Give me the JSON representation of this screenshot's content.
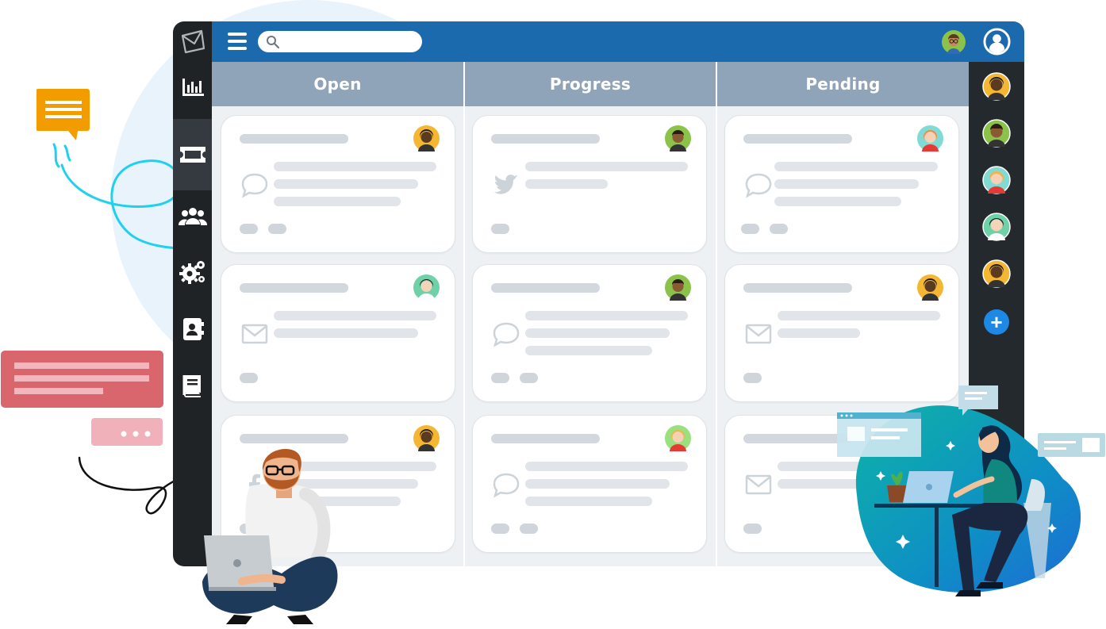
{
  "columns": [
    {
      "title": "Open",
      "cards": [
        {
          "channel": "chat-bubble-icon",
          "avatar": "dark-skin-woman"
        },
        {
          "channel": "envelope-icon",
          "avatar": "asian-woman"
        },
        {
          "channel": "facebook-icon",
          "avatar": "dark-skin-woman"
        }
      ]
    },
    {
      "title": "Progress",
      "cards": [
        {
          "channel": "twitter-icon",
          "avatar": "man-green"
        },
        {
          "channel": "chat-bubble-icon",
          "avatar": "man-green"
        },
        {
          "channel": "chat-bubble-icon",
          "avatar": "blonde-woman"
        }
      ]
    },
    {
      "title": "Pending",
      "cards": [
        {
          "channel": "chat-bubble-icon",
          "avatar": "redhead-woman"
        },
        {
          "channel": "envelope-icon",
          "avatar": "dark-skin-woman"
        },
        {
          "channel": "envelope-icon",
          "avatar": ""
        }
      ]
    }
  ],
  "colors": {
    "topbar": "#1a6aad",
    "sidebar": "#1f2326",
    "column_header": "#8fa4b9",
    "add_button": "#1e88e5"
  },
  "add_button_glyph": "+"
}
